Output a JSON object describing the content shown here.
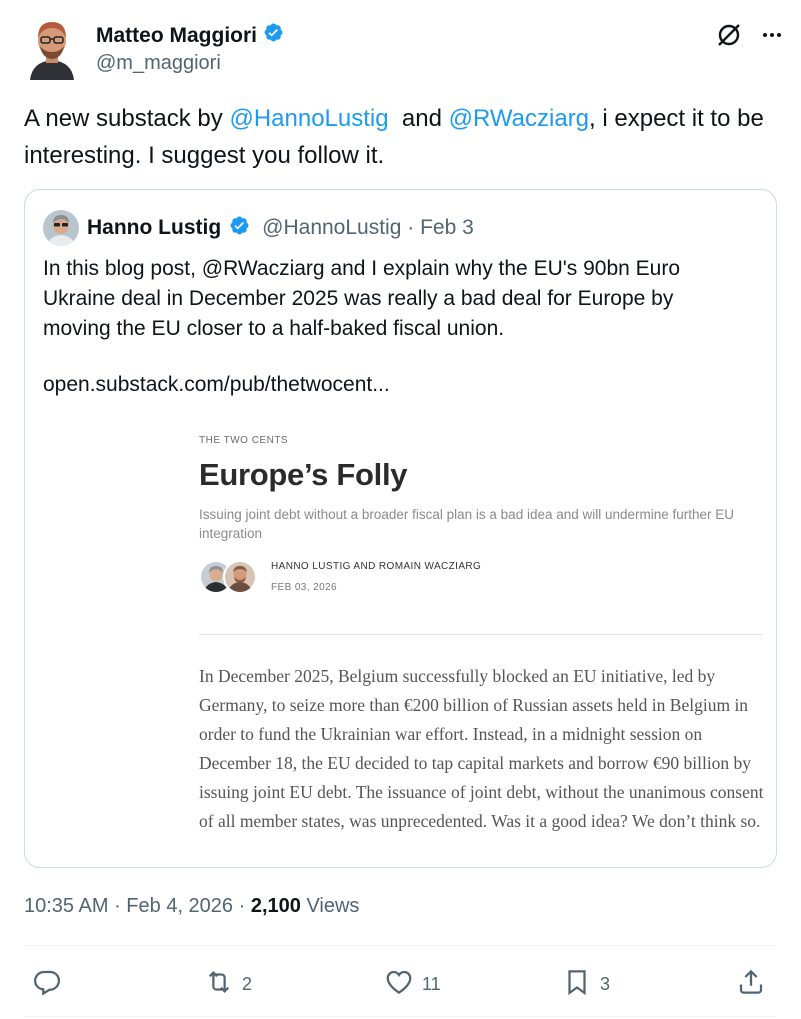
{
  "author": {
    "name": "Matteo Maggiori",
    "handle": "@m_maggiori"
  },
  "tweet": {
    "text_before": "A new substack by ",
    "mention1": "@HannoLustig",
    "text_mid": "  and ",
    "mention2": "@RWacziarg",
    "text_after": ", i expect it to be interesting. I suggest you follow it."
  },
  "quote": {
    "name": "Hanno Lustig",
    "handle": "@HannoLustig",
    "sep": " · ",
    "date": "Feb 3",
    "text": "In this blog post, @RWacziarg and I explain why the EU's 90bn Euro Ukraine deal in December 2025 was really a bad deal for Europe by moving the EU closer to a half-baked fiscal union.",
    "link": "open.substack.com/pub/thetwocent..."
  },
  "article": {
    "publication": "THE TWO CENTS",
    "title": "Europe’s Folly",
    "subtitle": "Issuing joint debt without a broader fiscal plan is a bad idea and will undermine further EU integration",
    "authors": "HANNO LUSTIG AND ROMAIN WACZIARG",
    "date": "FEB 03, 2026",
    "body": "In December 2025, Belgium successfully blocked an EU initiative, led by Germany, to seize more than €200 billion of Russian assets held in Belgium in order to fund the Ukrainian war effort. Instead, in a midnight session on December 18, the EU decided to tap capital markets and borrow €90 billion by issuing joint EU debt. The issuance of joint debt, without the unanimous consent of all member states, was unprecedented. Was it a good idea? We don’t think so."
  },
  "meta": {
    "time": "10:35 AM",
    "sep": " · ",
    "date": "Feb 4, 2026",
    "views_count": "2,100",
    "views_label": " Views"
  },
  "actions": {
    "reply_count": "",
    "retweet_count": "2",
    "like_count": "11",
    "bookmark_count": "3"
  },
  "colors": {
    "accent": "#1d9bf0",
    "muted": "#536471",
    "text": "#0f1419",
    "border": "#cfd9de"
  },
  "icons": [
    "verified-badge-icon",
    "grok-icon",
    "more-icon",
    "reply-icon",
    "retweet-icon",
    "like-icon",
    "bookmark-icon",
    "share-icon"
  ]
}
